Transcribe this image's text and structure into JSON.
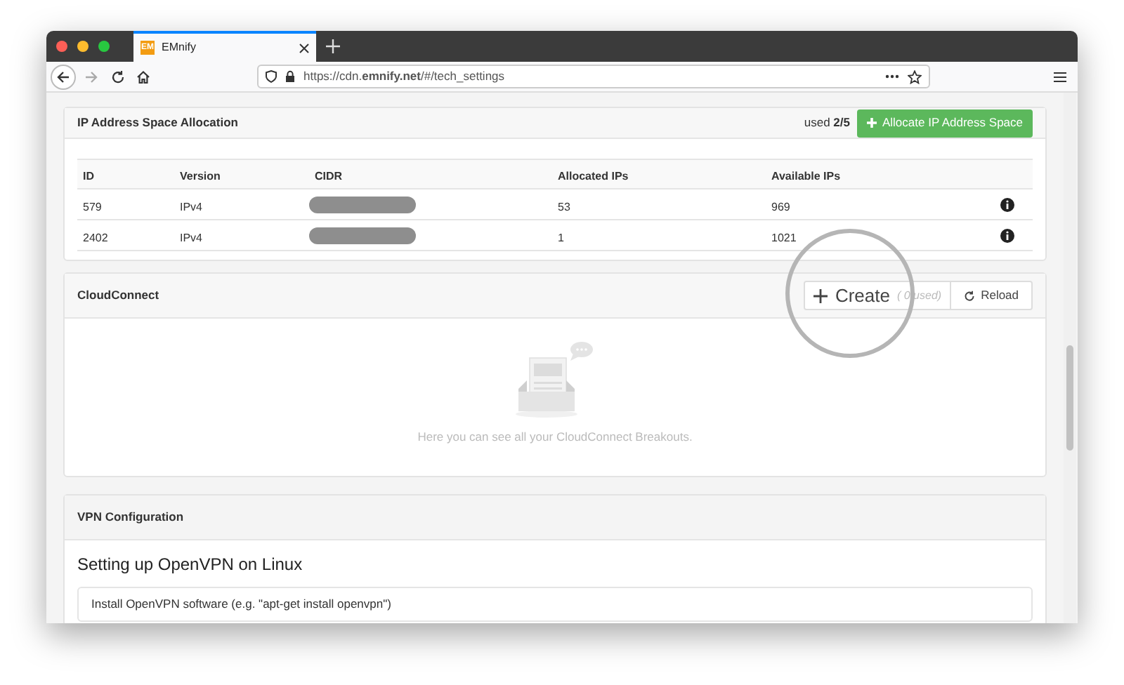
{
  "browser": {
    "tab_title": "EMnify",
    "favicon": "EM",
    "url": "https://cdn.**emnify.net**/#/tech_settings"
  },
  "ip_allocation": {
    "title": "IP Address Space Allocation",
    "usage": "used **2/5**",
    "button": "Allocate IP Address Space",
    "columns": [
      "ID",
      "Version",
      "CIDR",
      "Allocated IPs",
      "Available IPs"
    ],
    "rows": [
      {
        "id": "579",
        "version": "IPv4",
        "allocated": "53",
        "available": "969"
      },
      {
        "id": "2402",
        "version": "IPv4",
        "allocated": "1",
        "available": "1021"
      }
    ]
  },
  "cloudconnect": {
    "title": "CloudConnect",
    "create_button": "Create",
    "usage": "( 0 used)",
    "reload_button": "Reload",
    "empty_text": "Here you can see all your CloudConnect Breakouts."
  },
  "vpn": {
    "title": "VPN Configuration",
    "heading": "Setting up OpenVPN on Linux",
    "steps": [
      "Install OpenVPN software (e.g. \"apt-get install openvpn\")"
    ]
  }
}
